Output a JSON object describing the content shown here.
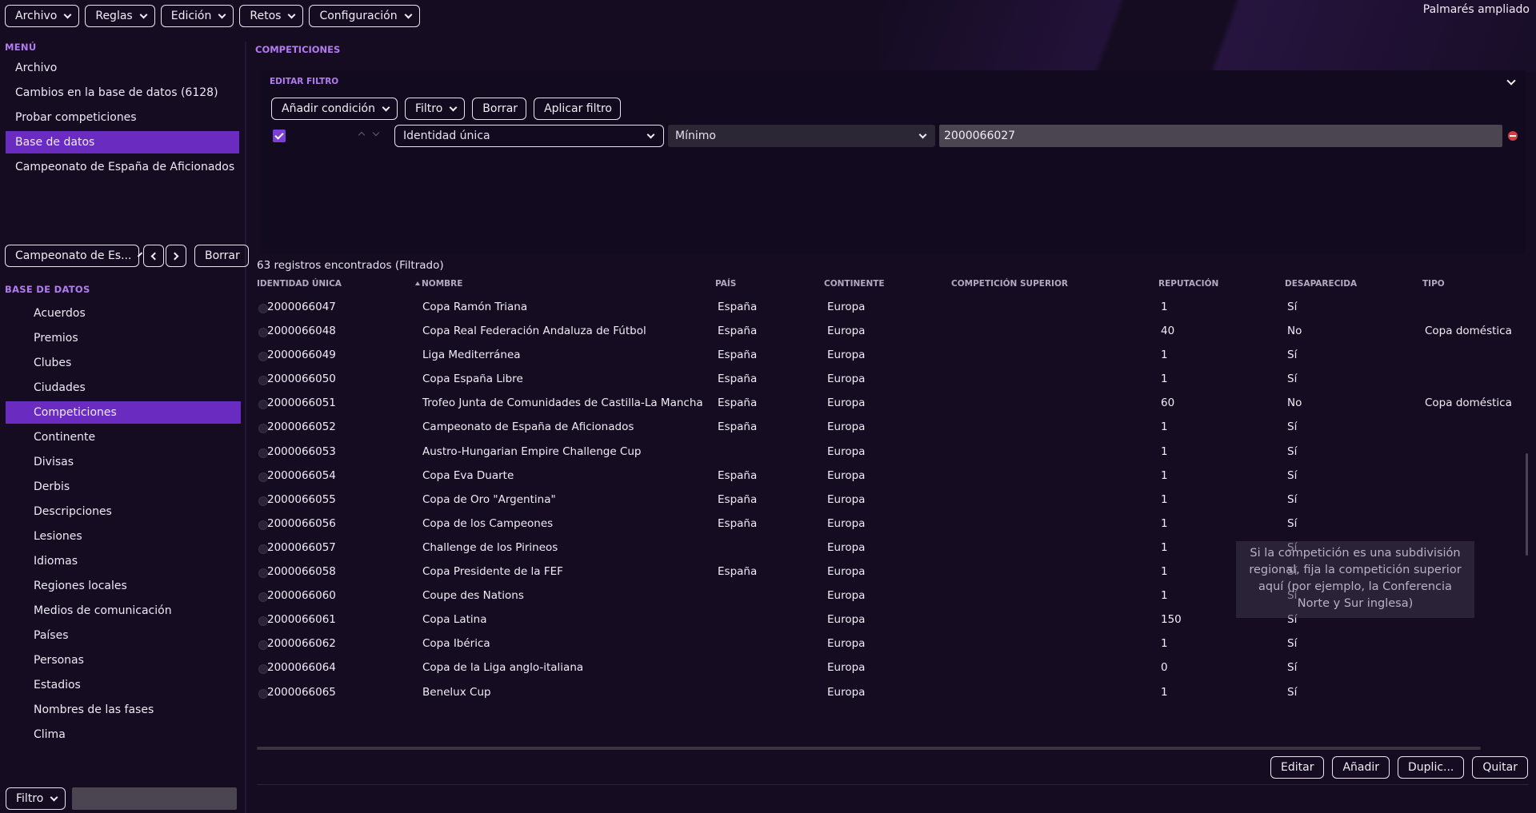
{
  "menu": {
    "items": [
      "Archivo",
      "Reglas",
      "Edición",
      "Retos",
      "Configuración"
    ],
    "right_label": "Palmarés ampliado"
  },
  "sidebar": {
    "menu_title": "MENÚ",
    "menu_items": [
      {
        "label": "Archivo",
        "active": false
      },
      {
        "label": "Cambios en la base de datos (6128)",
        "active": false
      },
      {
        "label": "Probar competiciones",
        "active": false
      },
      {
        "label": "Base de datos",
        "active": true
      },
      {
        "label": "Campeonato de España de Aficionados",
        "active": false
      }
    ],
    "selector_value": "Campeonato de Es...",
    "clear_label": "Borrar",
    "db_title": "BASE DE DATOS",
    "db_items": [
      {
        "label": "Acuerdos",
        "active": false
      },
      {
        "label": "Premios",
        "active": false
      },
      {
        "label": "Clubes",
        "active": false
      },
      {
        "label": "Ciudades",
        "active": false
      },
      {
        "label": "Competiciones",
        "active": true
      },
      {
        "label": "Continente",
        "active": false
      },
      {
        "label": "Divisas",
        "active": false
      },
      {
        "label": "Derbis",
        "active": false
      },
      {
        "label": "Descripciones",
        "active": false
      },
      {
        "label": "Lesiones",
        "active": false
      },
      {
        "label": "Idiomas",
        "active": false
      },
      {
        "label": "Regiones locales",
        "active": false
      },
      {
        "label": "Medios de comunicación",
        "active": false
      },
      {
        "label": "Países",
        "active": false
      },
      {
        "label": "Personas",
        "active": false
      },
      {
        "label": "Estadios",
        "active": false
      },
      {
        "label": "Nombres de las fases",
        "active": false
      },
      {
        "label": "Clima",
        "active": false
      }
    ],
    "filter_label": "Filtro",
    "search_value": ""
  },
  "main": {
    "title": "COMPETICIONES",
    "filter": {
      "title": "EDITAR FILTRO",
      "add_condition": "Añadir condición",
      "filter_label": "Filtro",
      "clear": "Borrar",
      "apply": "Aplicar filtro",
      "field": "Identidad única",
      "operator": "Mínimo",
      "value": "2000066027"
    },
    "records_text": "63 registros encontrados (Filtrado)",
    "columns": [
      "IDENTIDAD ÚNICA",
      "NOMBRE",
      "PAÍS",
      "CONTINENTE",
      "COMPETICIÓN SUPERIOR",
      "REPUTACIÓN",
      "DESAPARECIDA",
      "TIPO"
    ],
    "rows": [
      [
        "2000066047",
        "Copa Ramón Triana",
        "España",
        "Europa",
        "",
        "1",
        "Sí",
        ""
      ],
      [
        "2000066048",
        "Copa Real Federación Andaluza de Fútbol",
        "España",
        "Europa",
        "",
        "40",
        "No",
        "Copa doméstica"
      ],
      [
        "2000066049",
        "Liga Mediterránea",
        "España",
        "Europa",
        "",
        "1",
        "Sí",
        ""
      ],
      [
        "2000066050",
        "Copa España Libre",
        "España",
        "Europa",
        "",
        "1",
        "Sí",
        ""
      ],
      [
        "2000066051",
        "Trofeo Junta de Comunidades de Castilla-La Mancha",
        "España",
        "Europa",
        "",
        "60",
        "No",
        "Copa doméstica"
      ],
      [
        "2000066052",
        "Campeonato de España de Aficionados",
        "España",
        "Europa",
        "",
        "1",
        "Sí",
        ""
      ],
      [
        "2000066053",
        "Austro-Hungarian Empire Challenge Cup",
        "",
        "Europa",
        "",
        "1",
        "Sí",
        ""
      ],
      [
        "2000066054",
        "Copa Eva Duarte",
        "España",
        "Europa",
        "",
        "1",
        "Sí",
        ""
      ],
      [
        "2000066055",
        "Copa de Oro \"Argentina\"",
        "España",
        "Europa",
        "",
        "1",
        "Sí",
        ""
      ],
      [
        "2000066056",
        "Copa de los Campeones",
        "España",
        "Europa",
        "",
        "1",
        "Sí",
        ""
      ],
      [
        "2000066057",
        "Challenge de los Pirineos",
        "",
        "Europa",
        "",
        "1",
        "Sí",
        ""
      ],
      [
        "2000066058",
        "Copa Presidente de la FEF",
        "España",
        "Europa",
        "",
        "1",
        "Sí",
        ""
      ],
      [
        "2000066060",
        "Coupe des Nations",
        "",
        "Europa",
        "",
        "1",
        "Sí",
        ""
      ],
      [
        "2000066061",
        "Copa Latina",
        "",
        "Europa",
        "",
        "150",
        "Sí",
        ""
      ],
      [
        "2000066062",
        "Copa Ibérica",
        "",
        "Europa",
        "",
        "1",
        "Sí",
        ""
      ],
      [
        "2000066064",
        "Copa de la Liga anglo-italiana",
        "",
        "Europa",
        "",
        "0",
        "Sí",
        ""
      ],
      [
        "2000066065",
        "Benelux Cup",
        "",
        "Europa",
        "",
        "1",
        "Sí",
        ""
      ]
    ],
    "tooltip": "Si la competición es una subdivisión regional, fija la competición superior aquí (por ejemplo, la Conferencia Norte y Sur inglesa)",
    "actions": [
      "Editar",
      "Añadir",
      "Duplic...",
      "Quitar"
    ]
  },
  "colors": {
    "accent": "#6a2cc0",
    "section_title": "#b37bf0",
    "background": "#150c22"
  }
}
